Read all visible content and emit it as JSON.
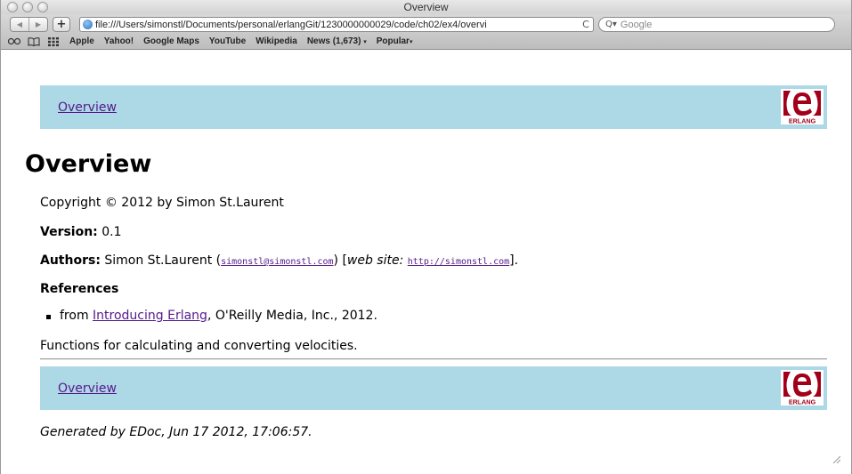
{
  "window": {
    "title": "Overview"
  },
  "toolbar": {
    "back_icon": "◀",
    "forward_icon": "▶",
    "add_label": "+",
    "url": "file:///Users/simonstl/Documents/personal/erlangGit/1230000000029/code/ch02/ex4/overvi",
    "reload_icon": "C",
    "search_placeholder": "Google",
    "search_icon": "Q▾"
  },
  "bookmarks": {
    "icons": [
      "reading-list-icon",
      "bookmarks-icon",
      "top-sites-icon"
    ],
    "items": [
      "Apple",
      "Yahoo!",
      "Google Maps",
      "YouTube",
      "Wikipedia",
      "News (1,673)",
      "Popular"
    ],
    "dropdown_arrow": "▾"
  },
  "page": {
    "nav_top_link": "Overview",
    "title": "Overview",
    "copyright": "Copyright © 2012 by Simon St.Laurent",
    "version_label": "Version:",
    "version_value": "0.1",
    "authors_label": "Authors:",
    "author_name": "Simon St.Laurent (",
    "author_email": "simonstl@simonstl.com",
    "author_mid": ") [",
    "website_label": "web site:",
    "website_url": "http://simonstl.com",
    "author_end": "].",
    "references_heading": "References",
    "ref_prefix": "from ",
    "ref_link": "Introducing Erlang",
    "ref_suffix": ", O'Reilly Media, Inc., 2012.",
    "description": "Functions for calculating and converting velocities.",
    "nav_bottom_link": "Overview",
    "generated": "Generated by EDoc, Jun 17 2012, 17:06:57.",
    "logo_text": "ERLANG",
    "logo_letter": "e"
  },
  "colors": {
    "navbar_bg": "#add8e6",
    "link": "#551a8b",
    "logo_red": "#a2001a"
  }
}
